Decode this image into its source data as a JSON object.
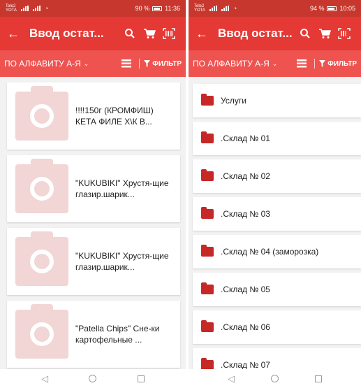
{
  "left": {
    "status": {
      "carrier": "Tele2\nYOTA",
      "battery": "90 %",
      "time": "11:36"
    },
    "toolbar": {
      "title": "Ввод остат..."
    },
    "sortbar": {
      "sort_label": "ПО АЛФАВИТУ А-Я",
      "filter_label": "ФИЛЬТР"
    },
    "items": [
      {
        "text": "!!!!150г (КРОМФИШ) КЕТА ФИЛЕ  Х\\К В..."
      },
      {
        "text": "\"KUKUBIKI\" Хрустя-щие глазир.шарик..."
      },
      {
        "text": "\"KUKUBIKI\" Хрустя-щие глазир.шарик..."
      },
      {
        "text": "\"Patella Chips\" Сне-ки картофельные ..."
      }
    ]
  },
  "right": {
    "status": {
      "carrier": "Tele2\nYOTA",
      "battery": "94 %",
      "time": "10:05"
    },
    "toolbar": {
      "title": "Ввод остат..."
    },
    "sortbar": {
      "sort_label": "ПО АЛФАВИТУ А-Я",
      "filter_label": "ФИЛЬТР"
    },
    "folders": [
      {
        "label": "Услуги"
      },
      {
        "label": ".Склад № 01"
      },
      {
        "label": ".Склад № 02"
      },
      {
        "label": ".Склад № 03"
      },
      {
        "label": ".Склад № 04 (заморозка)"
      },
      {
        "label": ".Склад № 05"
      },
      {
        "label": ".Склад № 06"
      },
      {
        "label": ".Склад № 07"
      }
    ]
  },
  "colors": {
    "toolbar": "#e53935",
    "sortbar": "#ef5350",
    "status": "#c8372d",
    "folder": "#c62828"
  },
  "icons": [
    "back-arrow-icon",
    "search-icon",
    "cart-icon",
    "barcode-icon",
    "chevron-down-icon",
    "list-icon",
    "filter-icon",
    "folder-icon",
    "camera-placeholder-icon"
  ]
}
